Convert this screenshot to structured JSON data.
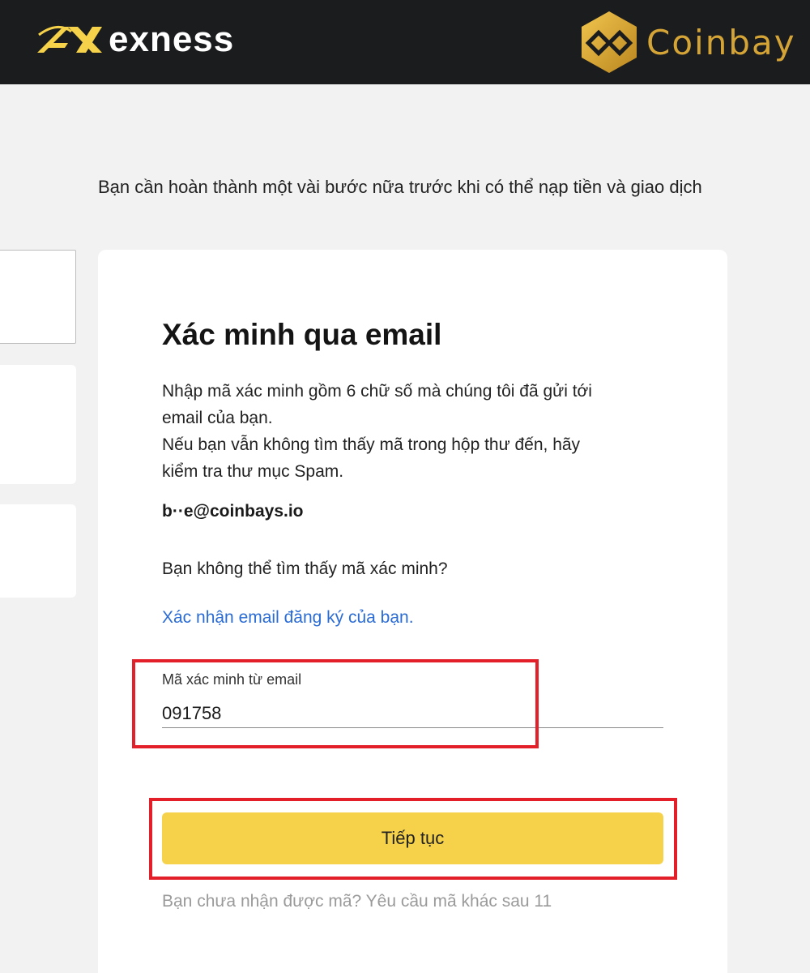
{
  "header": {
    "brand_left": "exness",
    "brand_right": "Coinbay",
    "brand_left_color": "#f6d24a",
    "brand_right_color": "#d4a437"
  },
  "intro_text": "Bạn cần hoàn thành một vài bước nữa trước khi có thể nạp tiền và giao dịch",
  "verify": {
    "title": "Xác minh qua email",
    "desc_lines": [
      "Nhập mã xác minh gồm 6 chữ số mà chúng tôi đã gửi tới",
      "email của bạn.",
      "Nếu bạn vẫn không tìm thấy mã trong hộp thư đến, hãy",
      "kiểm tra thư mục Spam."
    ],
    "email": "b··e@coinbays.io",
    "cant_find": "Bạn không thể tìm thấy mã xác minh?",
    "confirm_link": "Xác nhận email đăng ký của bạn.",
    "field_label": "Mã xác minh từ email",
    "code_value": "091758",
    "continue_label": "Tiếp tục",
    "resend_text": "Bạn chưa nhận được mã?  Yêu cầu mã khác sau 11"
  },
  "colors": {
    "accent_button": "#f6d24a",
    "link": "#2b6cd4",
    "highlight": "#e3202a",
    "topbar": "#1b1c1e"
  }
}
